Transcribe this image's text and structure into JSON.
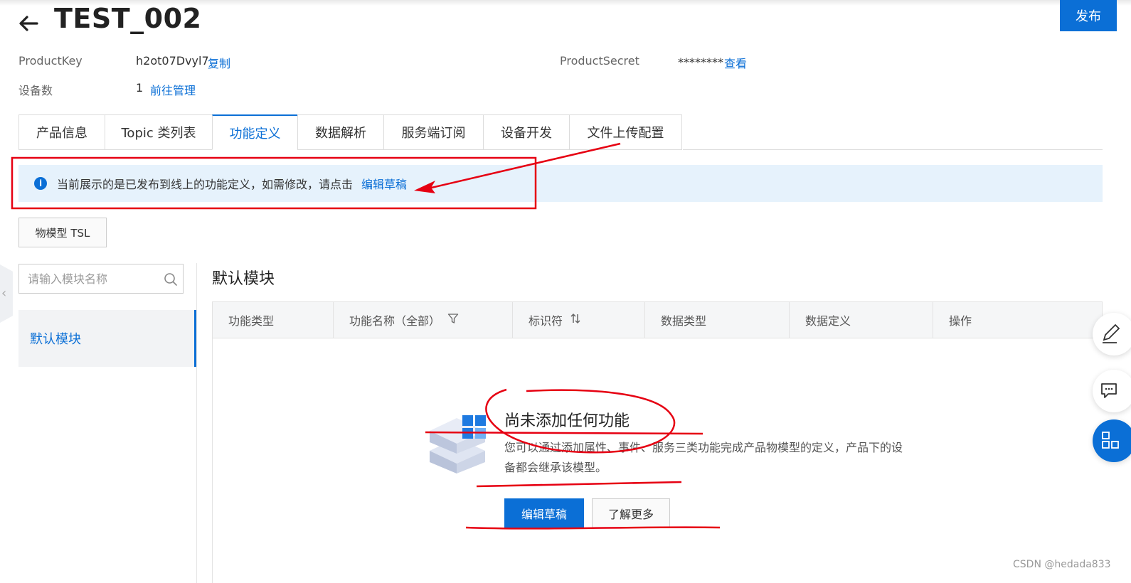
{
  "header": {
    "title": "TEST_002",
    "publish_label": "发布"
  },
  "meta": {
    "product_key_label": "ProductKey",
    "product_key_value": "h2ot07Dvyl7",
    "copy_label": "复制",
    "product_secret_label": "ProductSecret",
    "product_secret_value": "********",
    "view_label": "查看",
    "device_count_label": "设备数",
    "device_count_value": "1",
    "manage_label": "前往管理"
  },
  "tabs": [
    {
      "label": "产品信息",
      "active": false
    },
    {
      "label": "Topic 类列表",
      "active": false
    },
    {
      "label": "功能定义",
      "active": true
    },
    {
      "label": "数据解析",
      "active": false
    },
    {
      "label": "服务端订阅",
      "active": false
    },
    {
      "label": "设备开发",
      "active": false
    },
    {
      "label": "文件上传配置",
      "active": false
    }
  ],
  "notice": {
    "text": "当前展示的是已发布到线上的功能定义，如需修改，请点击",
    "link": "编辑草稿"
  },
  "tsl_button": "物模型 TSL",
  "sidebar": {
    "search_placeholder": "请输入模块名称",
    "items": [
      {
        "label": "默认模块",
        "active": true
      }
    ]
  },
  "module": {
    "title": "默认模块",
    "columns": [
      "功能类型",
      "功能名称（全部）",
      "标识符",
      "数据类型",
      "数据定义",
      "操作"
    ]
  },
  "empty": {
    "title": "尚未添加任何功能",
    "desc": "您可以通过添加属性、事件、服务三类功能完成产品物模型的定义，产品下的设备都会继承该模型。",
    "primary_button": "编辑草稿",
    "secondary_button": "了解更多"
  },
  "watermark": "CSDN @hedada833",
  "colors": {
    "accent": "#0b6fd6",
    "notice_bg": "#e6f2fc",
    "annotation_red": "#e60012"
  },
  "icons": {
    "back": "arrow-left-icon",
    "info": "info-circle-icon",
    "search": "search-icon",
    "filter": "filter-icon",
    "sort": "sort-icon",
    "float_1": "edit-icon",
    "float_2": "chat-icon",
    "float_3": "apps-icon"
  }
}
